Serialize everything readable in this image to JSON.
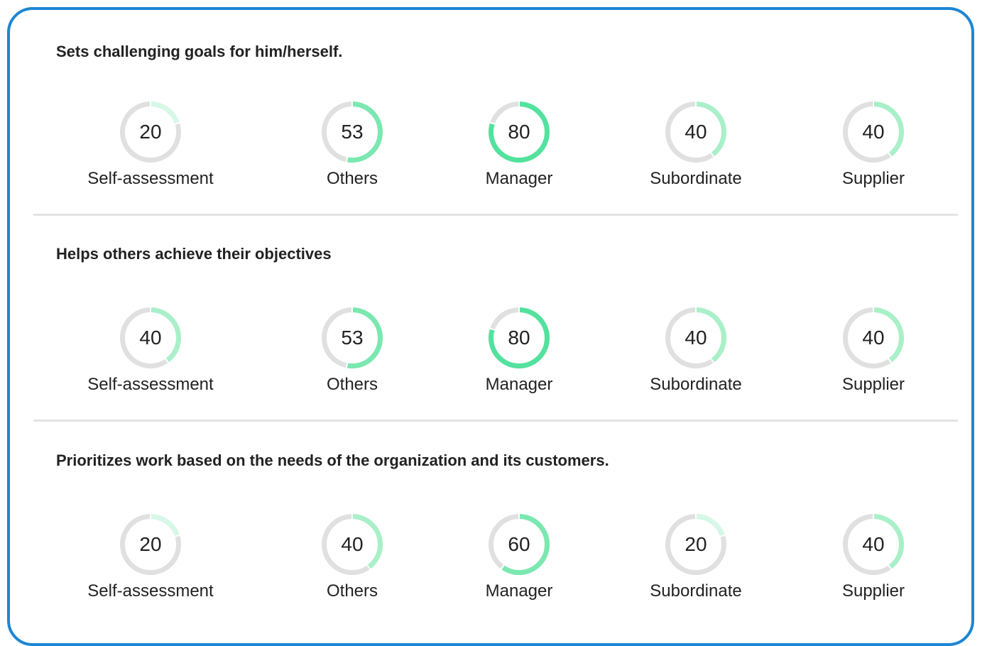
{
  "colors": {
    "border": "#1e86d3",
    "track": "#e0e0e0",
    "divider": "#e3e3e3",
    "fill_levels": {
      "20": "#d6f8e6",
      "40": "#a9f0c9",
      "53": "#7ae8b0",
      "60": "#7ae8b0",
      "80": "#52e29d"
    }
  },
  "sections": [
    {
      "title": "Sets challenging goals for him/herself.",
      "items": [
        {
          "label": "Self-assessment",
          "value": "20"
        },
        {
          "label": "Others",
          "value": "53"
        },
        {
          "label": "Manager",
          "value": "80"
        },
        {
          "label": "Subordinate",
          "value": "40"
        },
        {
          "label": "Supplier",
          "value": "40"
        }
      ]
    },
    {
      "title": "Helps others achieve their objectives",
      "items": [
        {
          "label": "Self-assessment",
          "value": "40"
        },
        {
          "label": "Others",
          "value": "53"
        },
        {
          "label": "Manager",
          "value": "80"
        },
        {
          "label": "Subordinate",
          "value": "40"
        },
        {
          "label": "Supplier",
          "value": "40"
        }
      ]
    },
    {
      "title": "Prioritizes work based on the needs of the organization and its customers.",
      "items": [
        {
          "label": "Self-assessment",
          "value": "20"
        },
        {
          "label": "Others",
          "value": "40"
        },
        {
          "label": "Manager",
          "value": "60"
        },
        {
          "label": "Subordinate",
          "value": "20"
        },
        {
          "label": "Supplier",
          "value": "40"
        }
      ]
    }
  ]
}
